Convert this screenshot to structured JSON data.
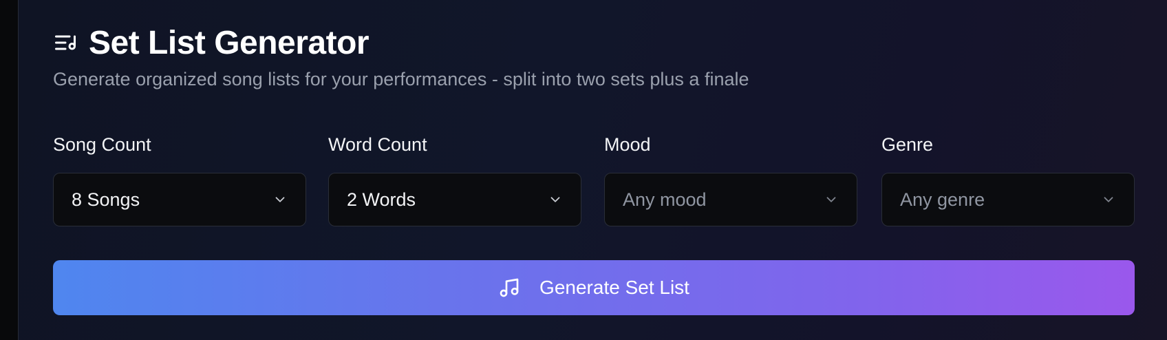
{
  "header": {
    "icon": "list-music-icon",
    "title": "Set List Generator",
    "subtitle": "Generate organized song lists for your performances - split into two sets plus a finale"
  },
  "filters": {
    "song_count": {
      "label": "Song Count",
      "value": "8 Songs"
    },
    "word_count": {
      "label": "Word Count",
      "value": "2 Words"
    },
    "mood": {
      "label": "Mood",
      "placeholder": "Any mood"
    },
    "genre": {
      "label": "Genre",
      "placeholder": "Any genre"
    }
  },
  "generate_button": {
    "icon": "music-note-icon",
    "label": "Generate Set List"
  },
  "colors": {
    "accent_start": "#4f86ef",
    "accent_end": "#9a58ec",
    "card_background": "#11162a",
    "select_background": "#0b0c0f"
  }
}
